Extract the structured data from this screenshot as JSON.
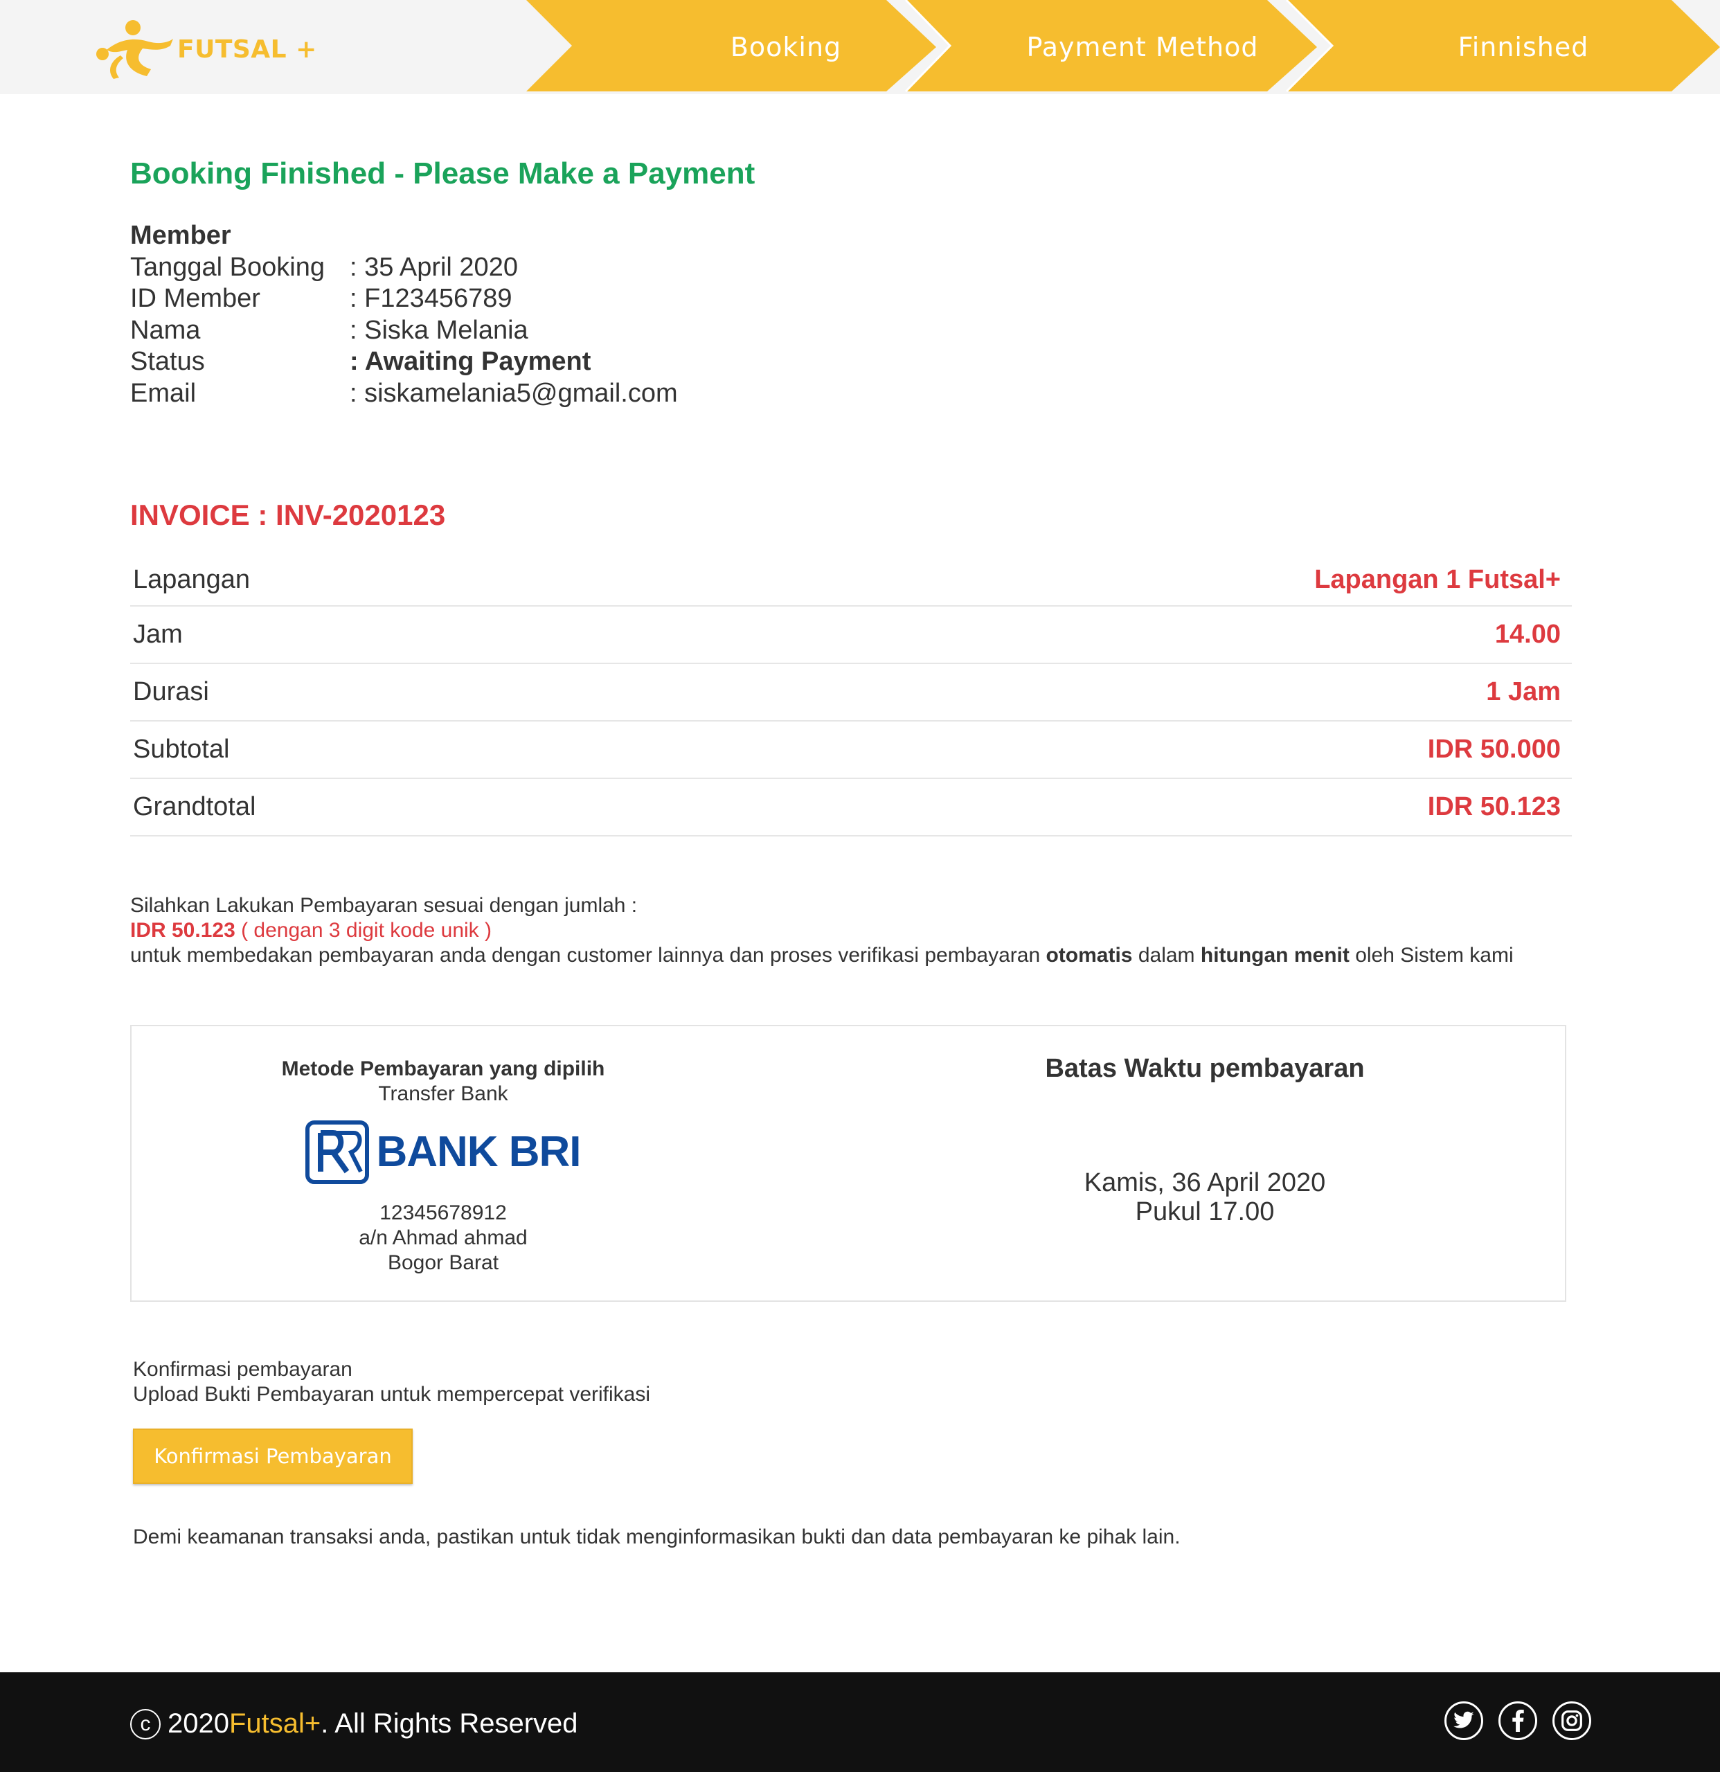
{
  "header": {
    "logo_text": "FUTSAL +",
    "steps": [
      {
        "label": "Booking"
      },
      {
        "label": "Payment Method"
      },
      {
        "label": "Finnished"
      }
    ],
    "accent_color": "#f6bd2f"
  },
  "booking": {
    "title": "Booking Finished - Please Make a Payment",
    "member_heading": "Member",
    "rows": [
      {
        "key": "Tanggal Booking",
        "value": ": 35 April 2020"
      },
      {
        "key": "ID Member",
        "value": ": F123456789"
      },
      {
        "key": "Nama",
        "value": ": Siska Melania"
      },
      {
        "key": "Status",
        "value": ": Awaiting Payment"
      },
      {
        "key": "Email",
        "value": ": siskamelania5@gmail.com"
      }
    ]
  },
  "invoice": {
    "title": "INVOICE : INV-2020123",
    "rows": [
      {
        "label": "Lapangan",
        "value": "Lapangan 1 Futsal+"
      },
      {
        "label": "Jam",
        "value": "14.00"
      },
      {
        "label": "Durasi",
        "value": "1 Jam"
      },
      {
        "label": "Subtotal",
        "value": "IDR 50.000"
      },
      {
        "label": "Grandtotal",
        "value": "IDR 50.123"
      }
    ]
  },
  "payment_note": {
    "line1": "Silahkan Lakukan Pembayaran sesuai dengan jumlah :",
    "amount": "IDR 50.123",
    "amount_note": " ( dengan 3 digit kode unik )",
    "line3_a": "untuk membedakan pembayaran anda dengan customer lainnya dan proses verifikasi pembayaran ",
    "line3_b": "otomatis",
    "line3_c": " dalam ",
    "line3_d": "hitungan menit",
    "line3_e": " oleh Sistem kami"
  },
  "method": {
    "title": "Metode Pembayaran yang dipilih",
    "type": "Transfer Bank",
    "bank_name": "BANK BRI",
    "account_number": "12345678912",
    "account_name": "a/n Ahmad ahmad",
    "branch": "Bogor Barat"
  },
  "deadline": {
    "title": "Batas Waktu pembayaran",
    "date": "Kamis, 36 April 2020",
    "time": "Pukul 17.00"
  },
  "confirm": {
    "line1": "Konfirmasi pembayaran",
    "line2": "Upload Bukti Pembayaran untuk mempercepat verifikasi",
    "button_label": "Konfirmasi Pembayaran",
    "security_note": "Demi keamanan transaksi anda, pastikan untuk tidak menginformasikan bukti dan data pembayaran ke pihak lain."
  },
  "footer": {
    "copyright_symbol": "c",
    "year": "2020 ",
    "brand": "Futsal+",
    "rights": ". All Rights Reserved",
    "social_icons": [
      "twitter-icon",
      "facebook-icon",
      "instagram-icon"
    ]
  }
}
